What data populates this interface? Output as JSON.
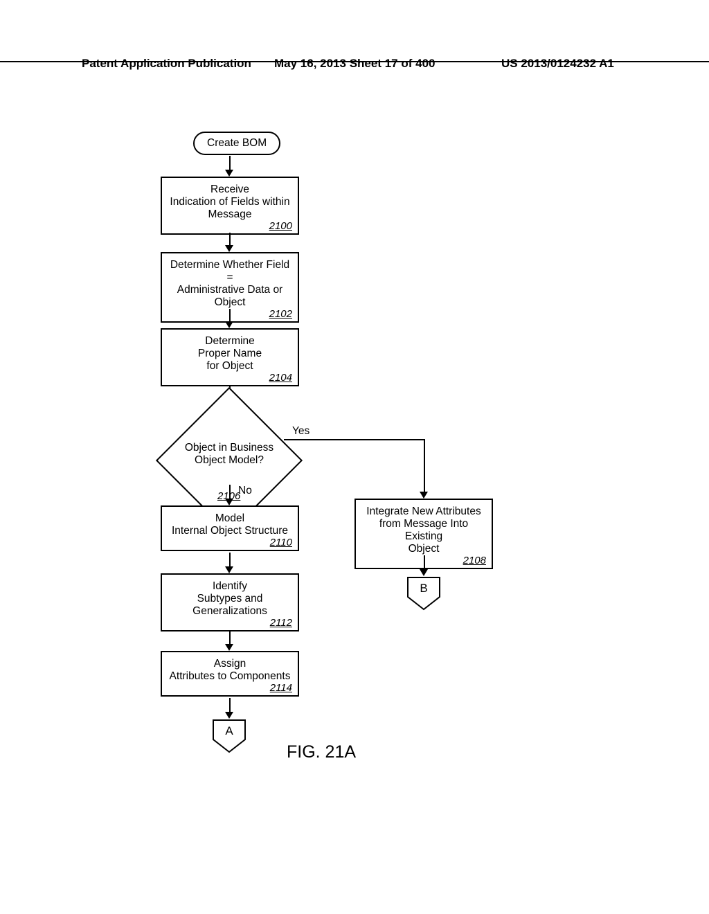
{
  "header": {
    "publication_type": "Patent Application Publication",
    "date_sheet": "May 16, 2013  Sheet 17 of 400",
    "pub_number": "US 2013/0124232 A1"
  },
  "figure_caption": "FIG. 21A",
  "terminator": {
    "label": "Create BOM"
  },
  "steps": {
    "s2100": {
      "text": "Receive\nIndication of Fields within\nMessage",
      "ref": "2100"
    },
    "s2102": {
      "text": "Determine Whether Field =\nAdministrative Data or\nObject",
      "ref": "2102"
    },
    "s2104": {
      "text": "Determine\nProper Name\nfor Object",
      "ref": "2104"
    },
    "s2106": {
      "text": "Object in Business\nObject Model?",
      "ref": "2106"
    },
    "s2108": {
      "text": "Integrate New Attributes\nfrom Message Into Existing\nObject",
      "ref": "2108"
    },
    "s2110": {
      "text": "Model\nInternal Object Structure",
      "ref": "2110"
    },
    "s2112": {
      "text": "Identify\nSubtypes and\nGeneralizations",
      "ref": "2112"
    },
    "s2114": {
      "text": "Assign\nAttributes to Components",
      "ref": "2114"
    }
  },
  "decision_edges": {
    "yes": "Yes",
    "no": "No"
  },
  "connectors": {
    "a": "A",
    "b": "B"
  },
  "chart_data": {
    "type": "flowchart",
    "title": "FIG. 21A",
    "nodes": [
      {
        "id": "start",
        "shape": "terminator",
        "label": "Create BOM"
      },
      {
        "id": "2100",
        "shape": "process",
        "label": "Receive Indication of Fields within Message"
      },
      {
        "id": "2102",
        "shape": "process",
        "label": "Determine Whether Field = Administrative Data or Object"
      },
      {
        "id": "2104",
        "shape": "process",
        "label": "Determine Proper Name for Object"
      },
      {
        "id": "2106",
        "shape": "decision",
        "label": "Object in Business Object Model?"
      },
      {
        "id": "2108",
        "shape": "process",
        "label": "Integrate New Attributes from Message Into Existing Object"
      },
      {
        "id": "2110",
        "shape": "process",
        "label": "Model Internal Object Structure"
      },
      {
        "id": "2112",
        "shape": "process",
        "label": "Identify Subtypes and Generalizations"
      },
      {
        "id": "2114",
        "shape": "process",
        "label": "Assign Attributes to Components"
      },
      {
        "id": "A",
        "shape": "offpage",
        "label": "A"
      },
      {
        "id": "B",
        "shape": "offpage",
        "label": "B"
      }
    ],
    "edges": [
      {
        "from": "start",
        "to": "2100"
      },
      {
        "from": "2100",
        "to": "2102"
      },
      {
        "from": "2102",
        "to": "2104"
      },
      {
        "from": "2104",
        "to": "2106"
      },
      {
        "from": "2106",
        "to": "2108",
        "label": "Yes"
      },
      {
        "from": "2106",
        "to": "2110",
        "label": "No"
      },
      {
        "from": "2108",
        "to": "B"
      },
      {
        "from": "2110",
        "to": "2112"
      },
      {
        "from": "2112",
        "to": "2114"
      },
      {
        "from": "2114",
        "to": "A"
      }
    ]
  }
}
